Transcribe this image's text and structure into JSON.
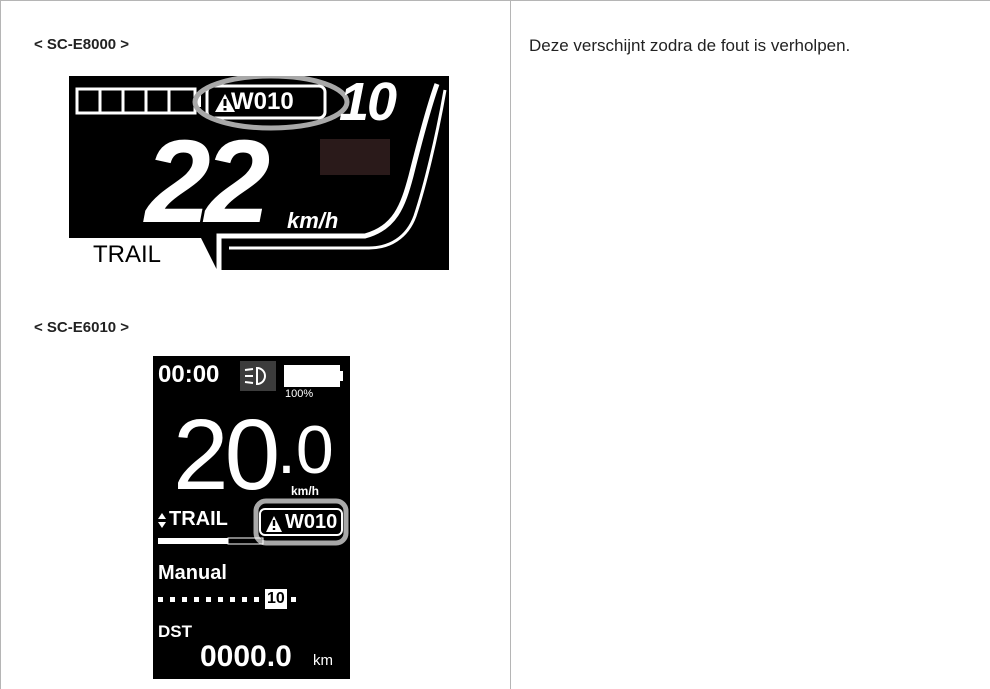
{
  "left": {
    "label_e8000": "< SC-E8000 >",
    "label_e6010": "< SC-E6010 >"
  },
  "right": {
    "description": "Deze verschijnt zodra de fout is verholpen."
  },
  "e8000": {
    "warning_code": "W010",
    "assist_level": "10",
    "speed": "22",
    "unit": "km/h",
    "mode": "TRAIL",
    "battery_segments": 5
  },
  "e6010": {
    "time": "00:00",
    "battery_percent": "100%",
    "speed_int": "20",
    "speed_dec": ".0",
    "unit": "km/h",
    "mode": "TRAIL",
    "warning_code": "W010",
    "shift_mode": "Manual",
    "gear": "10",
    "dst_label": "DST",
    "dst_value": "0000.0",
    "dst_unit": "km"
  }
}
